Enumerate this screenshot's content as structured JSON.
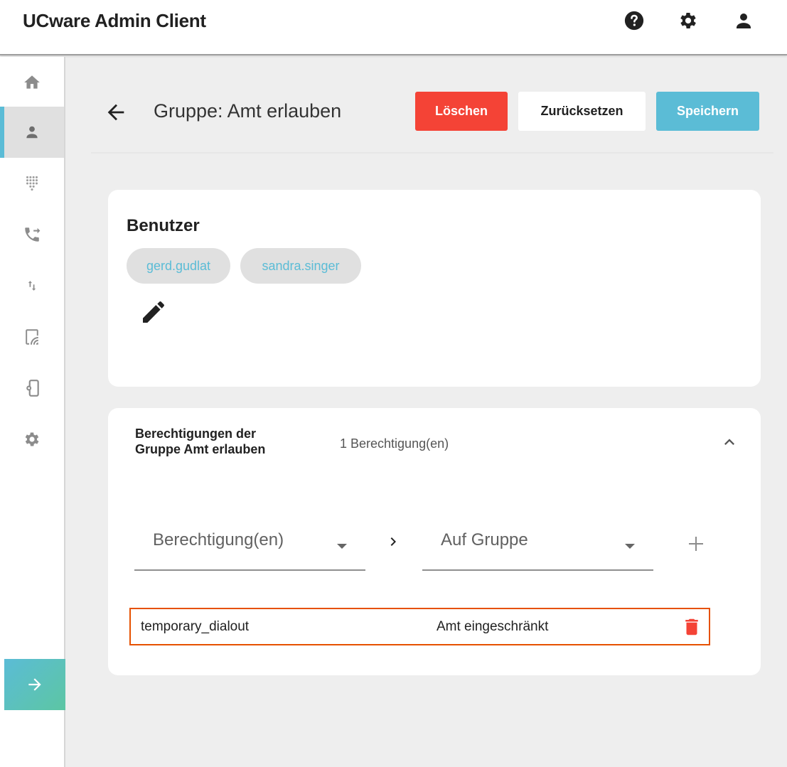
{
  "app": {
    "title": "UCware Admin Client"
  },
  "topbar": {
    "icons": [
      "help-icon",
      "settings-icon",
      "account-icon"
    ]
  },
  "sidebar": {
    "items": [
      {
        "icon": "home-icon",
        "active": false
      },
      {
        "icon": "user-icon",
        "active": true
      },
      {
        "icon": "dialpad-icon",
        "active": false
      },
      {
        "icon": "phone-forward-icon",
        "active": false
      },
      {
        "icon": "swap-vertical-icon",
        "active": false
      },
      {
        "icon": "cast-icon",
        "active": false
      },
      {
        "icon": "phonelink-setup-icon",
        "active": false
      },
      {
        "icon": "gear-icon",
        "active": false
      }
    ],
    "expand_icon": "arrow-right-icon",
    "accent": "#5bbcd6"
  },
  "header": {
    "title": "Gruppe: Amt erlauben",
    "delete_label": "Löschen",
    "reset_label": "Zurücksetzen",
    "save_label": "Speichern"
  },
  "users_card": {
    "title": "Benutzer",
    "chips": [
      "gerd.gudlat",
      "sandra.singer"
    ]
  },
  "permissions_card": {
    "title": "Berechtigungen der Gruppe Amt erlauben",
    "count": "1 Berechtigung(en)",
    "permission_select_placeholder": "Berechtigung(en)",
    "group_select_placeholder": "Auf Gruppe",
    "rows": [
      {
        "permission": "temporary_dialout",
        "group": "Amt eingeschränkt"
      }
    ]
  },
  "colors": {
    "delete": "#f44336",
    "save": "#5bbcd6",
    "chip_text": "#5bbcd6",
    "highlight_border": "#e65100"
  }
}
